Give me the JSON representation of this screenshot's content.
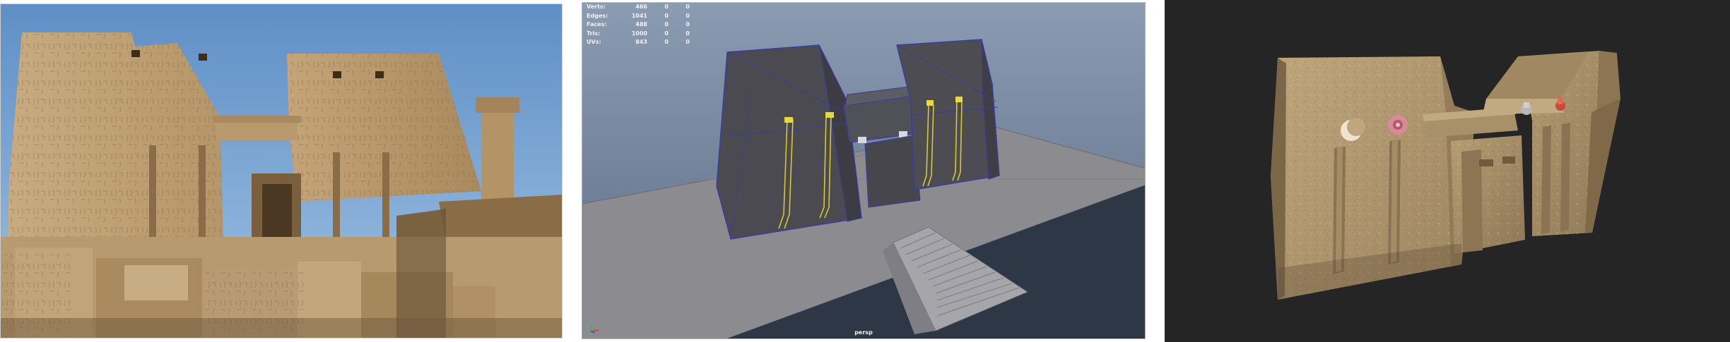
{
  "photo": {
    "scene": "temple-pylon-photo"
  },
  "viewport": {
    "stats": [
      {
        "label": "Verts:",
        "value": "466",
        "sel": "0",
        "comp": "0"
      },
      {
        "label": "Edges:",
        "value": "1041",
        "sel": "0",
        "comp": "0"
      },
      {
        "label": "Faces:",
        "value": "488",
        "sel": "0",
        "comp": "0"
      },
      {
        "label": "Tris:",
        "value": "1000",
        "sel": "0",
        "comp": "0"
      },
      {
        "label": "UVs:",
        "value": "843",
        "sel": "0",
        "comp": "0"
      }
    ],
    "camera": "persp",
    "colors": {
      "sky_top": "#8c9bb0",
      "sky_bottom": "#4b5a70",
      "mesh": "#4a4a50",
      "wire": "#3a3aa8",
      "highlight": "#d8c830",
      "floor": "#8a8a8e"
    }
  },
  "render": {
    "background": "#252525",
    "stone": "#b69e74"
  }
}
